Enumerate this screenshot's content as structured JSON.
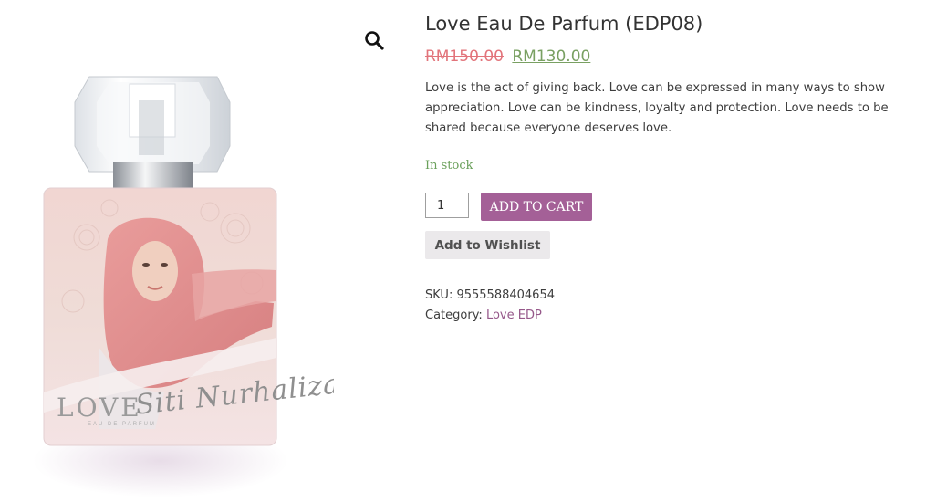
{
  "product": {
    "title": "Love Eau De Parfum (EDP08)",
    "regular_price": "RM150.00",
    "sale_price": "RM130.00",
    "description": "Love is the act of giving back. Love can be expressed in many ways to show appreciation. Love can be kindness, loyalty and protection. Love needs to be shared because everyone deserves love.",
    "stock_status": "In stock",
    "quantity": "1",
    "add_to_cart_label": "ADD TO CART",
    "wishlist_label": "Add to Wishlist",
    "sku_label": "SKU:",
    "sku_value": "9555588404654",
    "category_label": "Category:",
    "category_value": "Love EDP"
  },
  "image": {
    "bottle_brand": "LOVE",
    "bottle_subtext": "EAU DE PARFUM",
    "bottle_signature": "Siti Nurhaliza"
  },
  "icons": {
    "zoom": "search-icon"
  },
  "colors": {
    "accent": "#a46097",
    "sale_price": "#79a062",
    "regular_price": "#e2747b",
    "in_stock": "#6aa05b",
    "category_link": "#96588a",
    "wishlist_bg": "#ebe9eb"
  }
}
